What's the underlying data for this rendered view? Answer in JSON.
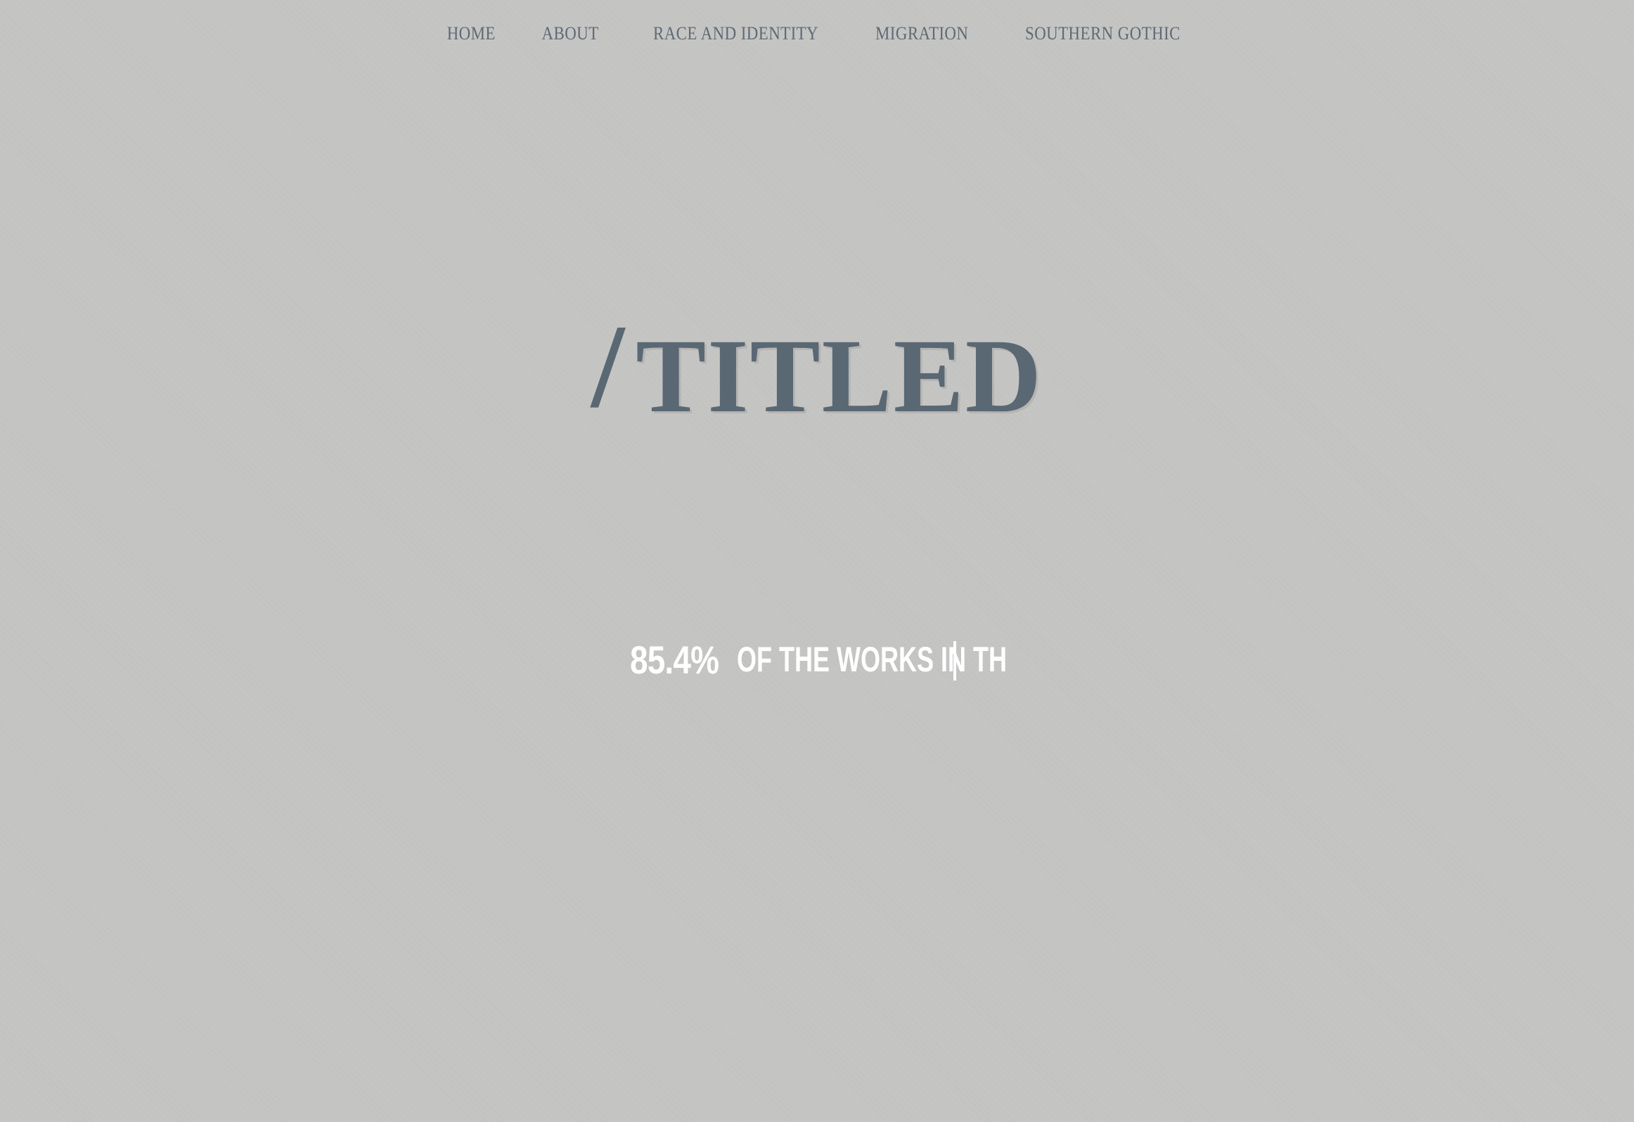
{
  "nav": {
    "items": [
      {
        "label": "HOME"
      },
      {
        "label": "ABOUT"
      },
      {
        "label": "RACE AND IDENTITY"
      },
      {
        "label": "MIGRATION"
      },
      {
        "label": "SOUTHERN GOTHIC"
      }
    ]
  },
  "hero": {
    "slash": "/",
    "title": "TITLED"
  },
  "stat": {
    "number": "85.4%",
    "text": "OF THE WORKS IN TH"
  },
  "colors": {
    "background": "#c6c6c5",
    "nav_text": "#5f6a74",
    "title_text": "#5a6873",
    "stat_text": "#ffffff"
  }
}
